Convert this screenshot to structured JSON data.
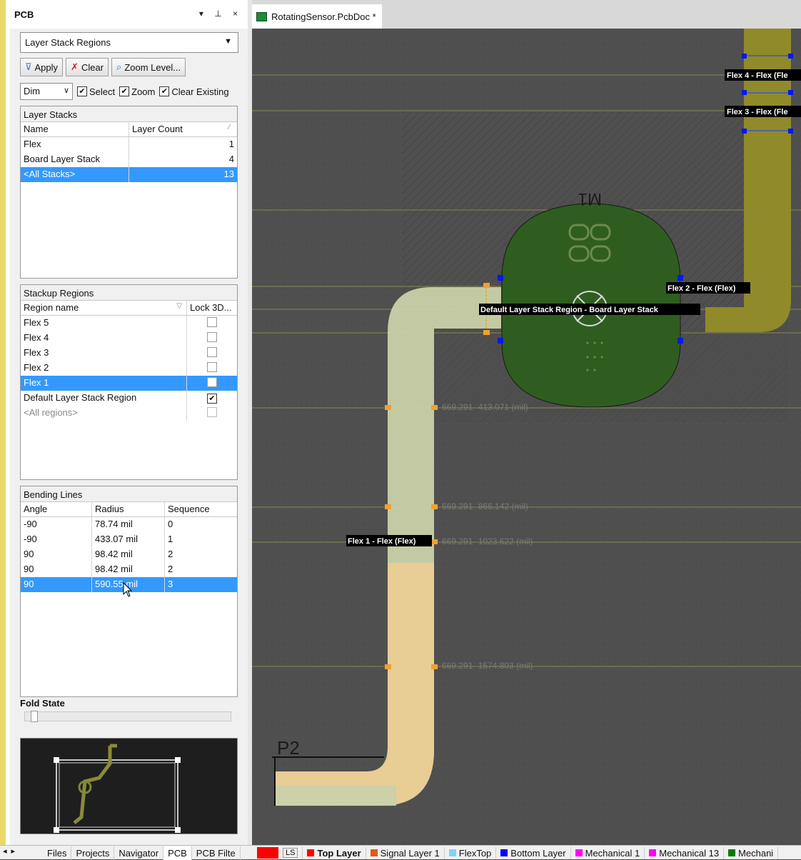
{
  "panel": {
    "title": "PCB",
    "controls": "▾ ⊥ ×",
    "mode": "Layer Stack Regions",
    "toolbar": {
      "apply": "Apply",
      "clear": "Clear",
      "zoom_level": "Zoom Level..."
    },
    "options": {
      "dim": "Dim",
      "select": "Select",
      "zoom": "Zoom",
      "clear_existing": "Clear Existing"
    }
  },
  "layer_stacks": {
    "title": "Layer Stacks",
    "headers": [
      "Name",
      "Layer Count"
    ],
    "rows": [
      {
        "name": "Flex",
        "count": "1"
      },
      {
        "name": "Board Layer Stack",
        "count": "4"
      },
      {
        "name": "<All Stacks>",
        "count": "13"
      }
    ]
  },
  "stackup_regions": {
    "title": "Stackup Regions",
    "headers": [
      "Region name",
      "Lock 3D..."
    ],
    "rows": [
      {
        "name": "Flex 5",
        "lock": false
      },
      {
        "name": "Flex 4",
        "lock": false
      },
      {
        "name": "Flex 3",
        "lock": false
      },
      {
        "name": "Flex 2",
        "lock": false
      },
      {
        "name": "Flex 1",
        "lock": false
      },
      {
        "name": "Default Layer Stack Region",
        "lock": true
      },
      {
        "name": "<All regions>",
        "lock": false
      }
    ]
  },
  "bending_lines": {
    "title": "Bending Lines",
    "headers": [
      "Angle",
      "Radius",
      "Sequence"
    ],
    "rows": [
      {
        "angle": "-90",
        "radius": "78.74 mil",
        "seq": "0"
      },
      {
        "angle": "-90",
        "radius": "433.07 mil",
        "seq": "1"
      },
      {
        "angle": "90",
        "radius": "98.42 mil",
        "seq": "2"
      },
      {
        "angle": "90",
        "radius": "98.42 mil",
        "seq": "2"
      },
      {
        "angle": "90",
        "radius": "590.55 mil",
        "seq": "3"
      }
    ]
  },
  "fold_state": {
    "label": "Fold State",
    "value": 0
  },
  "document": {
    "tab": "RotatingSensor.PcbDoc *"
  },
  "canvas_labels": {
    "flex4": "Flex 4 - Flex (Fle",
    "flex3": "Flex 3 - Flex (Fle",
    "flex2": "Flex 2 - Flex (Flex)",
    "default_region": "Default Layer Stack Region - Board Layer Stack",
    "flex1": "Flex 1 - Flex (Flex)",
    "m1": "M1",
    "p2": "P2",
    "coord1": "-669.291 -413.071 (mil)",
    "coord2": "-669.291 -866.142 (mil)",
    "coord3": "-669.291 -1023.622 (mil)",
    "coord4": "-669.291 -1574.803 (mil)"
  },
  "panel_tabs": [
    "Files",
    "Projects",
    "Navigator",
    "PCB",
    "PCB Filte"
  ],
  "layer_tabs": [
    {
      "label": "LS",
      "color": "#ff0000"
    },
    {
      "label": "Top Layer",
      "color": "#ff0000"
    },
    {
      "label": "Signal Layer 1",
      "color": "#e05a1a"
    },
    {
      "label": "FlexTop",
      "color": "#7fd3f7"
    },
    {
      "label": "Bottom Layer",
      "color": "#0000ff"
    },
    {
      "label": "Mechanical 1",
      "color": "#ff00ff"
    },
    {
      "label": "Mechanical 13",
      "color": "#ff00ff"
    },
    {
      "label": "Mechani",
      "color": "#008000"
    }
  ]
}
